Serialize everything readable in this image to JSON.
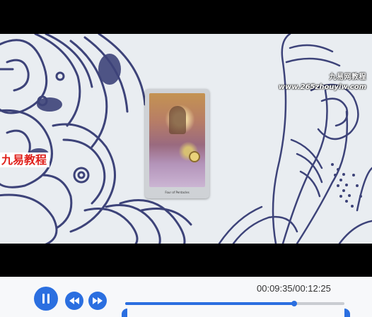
{
  "video": {
    "watermark_left": "九易教程",
    "watermark_right_cn": "九易网教程",
    "watermark_url": "www.265zhouyiw.com",
    "card_caption": "Four of Pentacles"
  },
  "controls": {
    "time_display": "00:09:35/00:12:25",
    "progress_fraction": 0.772,
    "accent_color": "#2b6fe0"
  },
  "icons": {
    "play_pause": "pause-icon",
    "rewind": "rewind-icon",
    "fast_forward": "fast-forward-icon"
  }
}
